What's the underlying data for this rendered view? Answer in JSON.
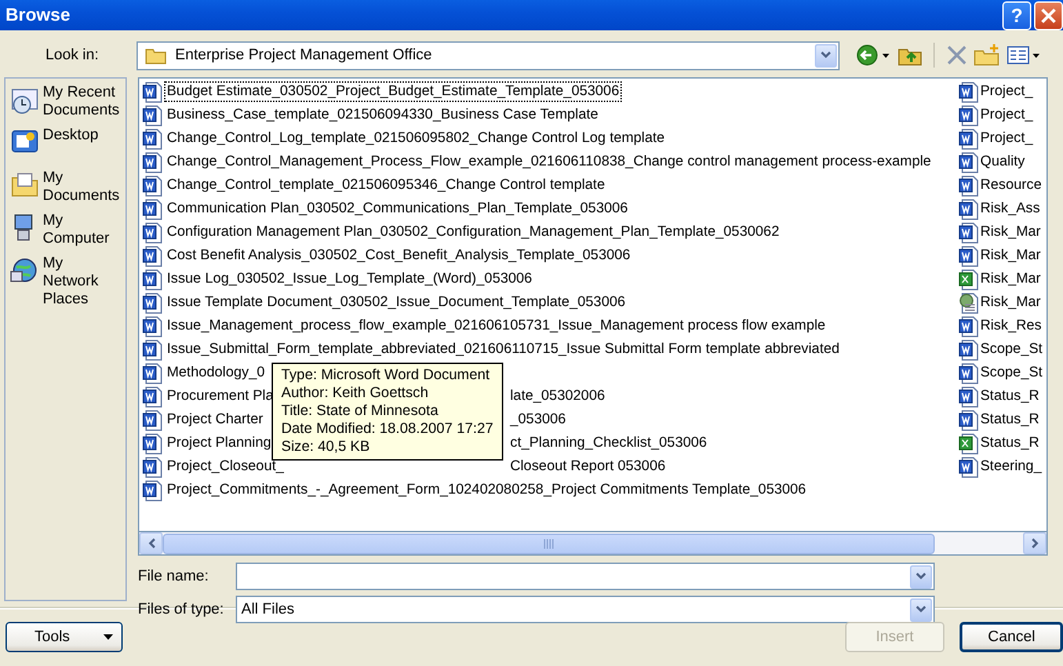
{
  "window": {
    "title": "Browse",
    "help": "?"
  },
  "look_in": {
    "label": "Look in:",
    "value": "Enterprise Project Management Office"
  },
  "places": [
    {
      "label": "My Recent Documents",
      "kind": "recent"
    },
    {
      "label": "Desktop",
      "kind": "desktop"
    },
    {
      "label": "My Documents",
      "kind": "documents"
    },
    {
      "label": "My Computer",
      "kind": "computer"
    },
    {
      "label": "My Network Places",
      "kind": "network"
    }
  ],
  "files": [
    {
      "name": "Budget Estimate_030502_Project_Budget_Estimate_Template_053006",
      "kind": "word",
      "focused": true
    },
    {
      "name": "Business_Case_template_021506094330_Business Case Template",
      "kind": "word",
      "focused": false
    },
    {
      "name": "Change_Control_Log_template_021506095802_Change Control Log template",
      "kind": "word",
      "focused": false
    },
    {
      "name": "Change_Control_Management_Process_Flow_example_021606110838_Change control management process-example",
      "kind": "word",
      "focused": false
    },
    {
      "name": "Change_Control_template_021506095346_Change Control template",
      "kind": "word",
      "focused": false
    },
    {
      "name": "Communication Plan_030502_Communications_Plan_Template_053006",
      "kind": "word",
      "focused": false
    },
    {
      "name": "Configuration Management Plan_030502_Configuration_Management_Plan_Template_0530062",
      "kind": "word",
      "focused": false
    },
    {
      "name": "Cost Benefit Analysis_030502_Cost_Benefit_Analysis_Template_053006",
      "kind": "word",
      "focused": false
    },
    {
      "name": "Issue Log_030502_Issue_Log_Template_(Word)_053006",
      "kind": "word",
      "focused": false
    },
    {
      "name": "Issue Template Document_030502_Issue_Document_Template_053006",
      "kind": "word",
      "focused": false
    },
    {
      "name": "Issue_Management_process_flow_example_021606105731_Issue_Management process flow example",
      "kind": "word",
      "focused": false
    },
    {
      "name": "Issue_Submittal_Form_template_abbreviated_021606110715_Issue Submittal Form template abbreviated",
      "kind": "word",
      "focused": false
    },
    {
      "name": "Methodology_0",
      "kind": "word",
      "focused": false
    },
    {
      "name": "Procurement Pla",
      "name_end": "late_05302006",
      "kind": "word",
      "focused": false
    },
    {
      "name": "Project Charter",
      "name_end": "_053006",
      "kind": "word",
      "focused": false
    },
    {
      "name": "Project Planning",
      "name_end": "ct_Planning_Checklist_053006",
      "kind": "word",
      "focused": false
    },
    {
      "name": "Project_Closeout_",
      "name_end": "Closeout Report 053006",
      "kind": "word",
      "focused": false
    },
    {
      "name": "Project_Commitments_-_Agreement_Form_102402080258_Project Commitments Template_053006",
      "kind": "word",
      "focused": false
    }
  ],
  "files_column_2": [
    {
      "name": "Project_",
      "kind": "word"
    },
    {
      "name": "Project_",
      "kind": "word"
    },
    {
      "name": "Project_",
      "kind": "word"
    },
    {
      "name": "Quality",
      "kind": "word"
    },
    {
      "name": "Resource",
      "kind": "word"
    },
    {
      "name": "Risk_Ass",
      "kind": "word"
    },
    {
      "name": "Risk_Mar",
      "kind": "word"
    },
    {
      "name": "Risk_Mar",
      "kind": "word"
    },
    {
      "name": "Risk_Mar",
      "kind": "excel"
    },
    {
      "name": "Risk_Mar",
      "kind": "other"
    },
    {
      "name": "Risk_Res",
      "kind": "word"
    },
    {
      "name": "Scope_St",
      "kind": "word"
    },
    {
      "name": "Scope_St",
      "kind": "word"
    },
    {
      "name": "Status_R",
      "kind": "word"
    },
    {
      "name": "Status_R",
      "kind": "word"
    },
    {
      "name": "Status_R",
      "kind": "excel"
    },
    {
      "name": "Steering_",
      "kind": "word"
    }
  ],
  "tooltip": [
    "Type: Microsoft Word Document",
    "Author: Keith Goettsch",
    "Title: State of Minnesota",
    "Date Modified: 18.08.2007 17:27",
    "Size: 40,5 KB"
  ],
  "file_name": {
    "label": "File name:"
  },
  "file_type": {
    "label": "Files of type:",
    "value": "All Files"
  },
  "buttons": {
    "tools": "Tools",
    "insert": {
      "label": "Insert",
      "disabled": true
    },
    "cancel": {
      "label": "Cancel",
      "disabled": false
    }
  }
}
